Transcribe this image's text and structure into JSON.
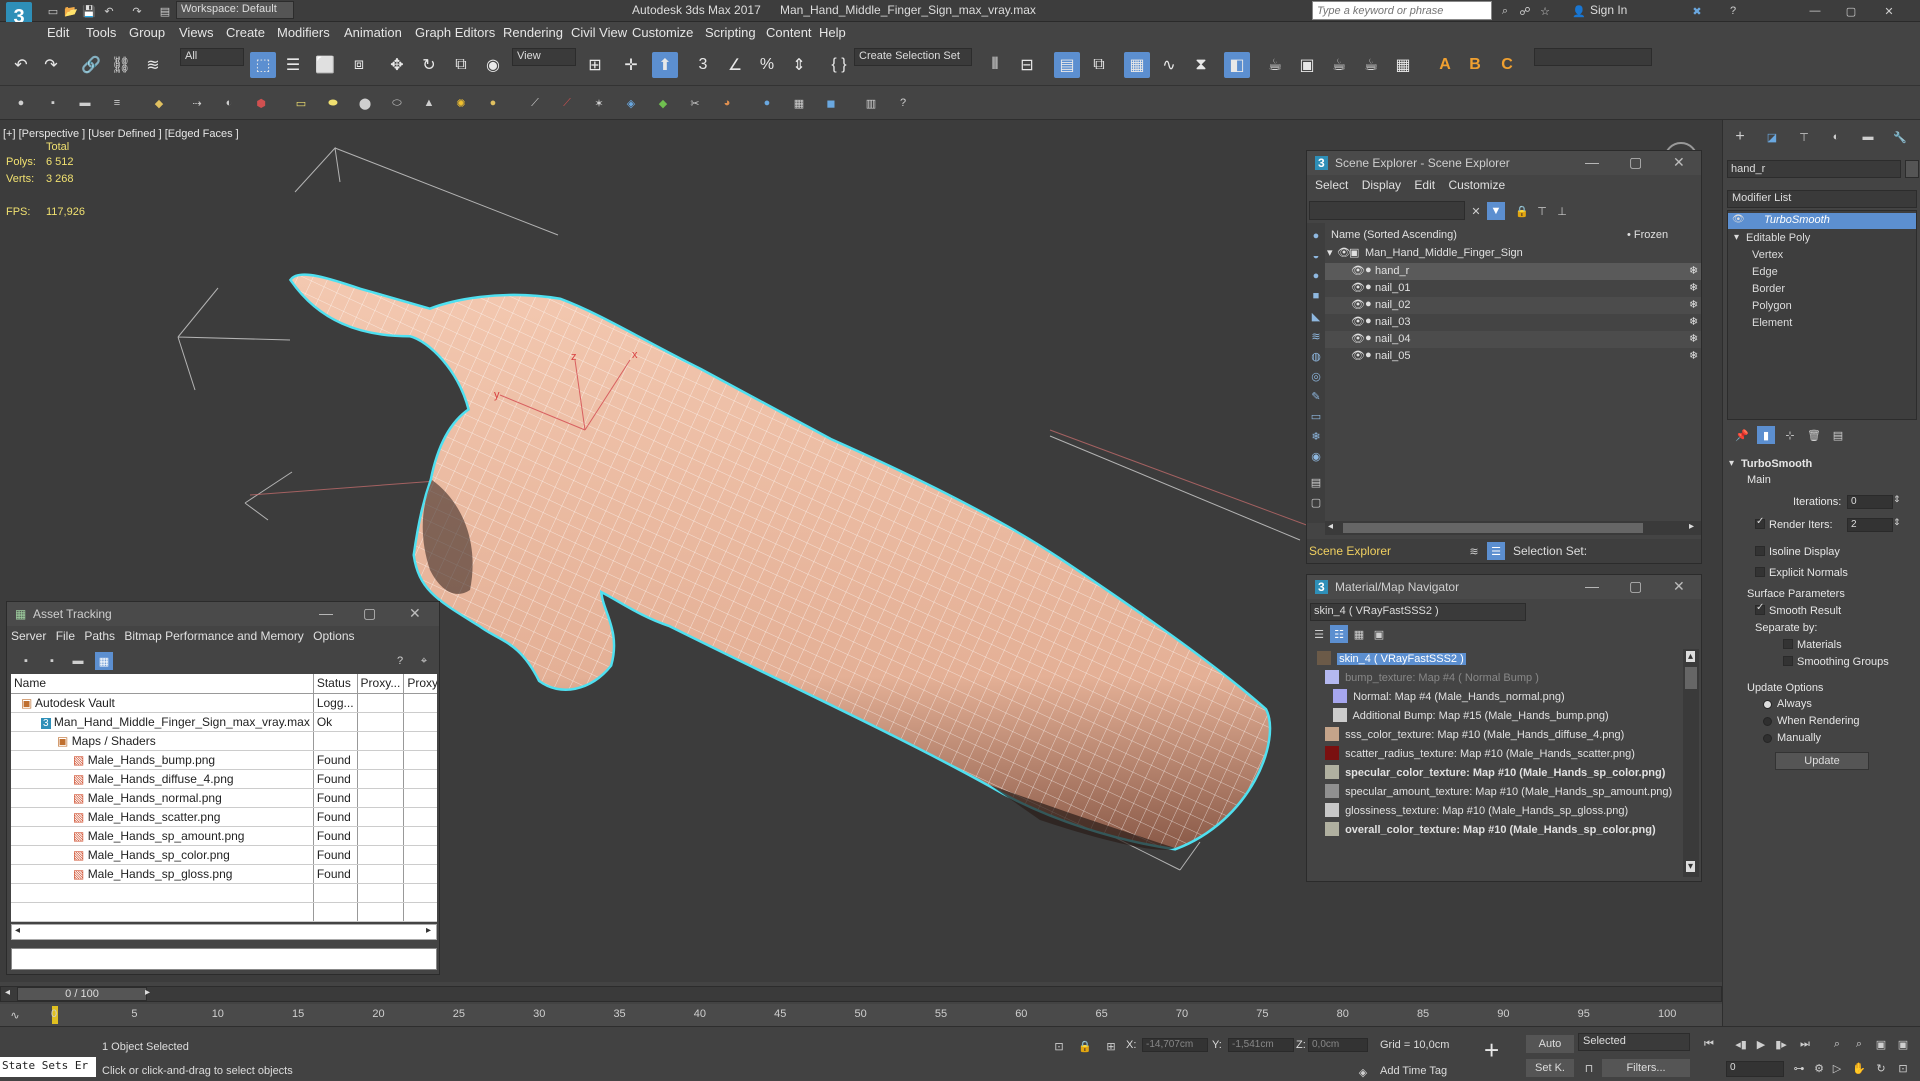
{
  "titlebar": {
    "app_title": "Autodesk 3ds Max 2017",
    "file_title": "Man_Hand_Middle_Finger_Sign_max_vray.max",
    "workspace": "Workspace: Default",
    "search_placeholder": "Type a keyword or phrase",
    "sign_in": "Sign In"
  },
  "menu": [
    "Edit",
    "Tools",
    "Group",
    "Views",
    "Create",
    "Modifiers",
    "Animation",
    "Graph Editors",
    "Rendering",
    "Civil View",
    "Customize",
    "Scripting",
    "Content",
    "Help"
  ],
  "toolbar": {
    "selection_filter": "All",
    "ref_coord": "View",
    "create_selection_set": "Create Selection Set"
  },
  "viewport": {
    "label": "[+] [Perspective ] [User Defined ] [Edged Faces ]",
    "stats_total": "Total",
    "polys_label": "Polys:",
    "polys_value": "6 512",
    "verts_label": "Verts:",
    "verts_value": "3 268",
    "fps_label": "FPS:",
    "fps_value": "117,926",
    "gizmo": {
      "x": "x",
      "y": "y",
      "z": "z"
    }
  },
  "scene_explorer": {
    "title": "Scene Explorer - Scene Explorer",
    "menu": [
      "Select",
      "Display",
      "Edit",
      "Customize"
    ],
    "col_name": "Name (Sorted Ascending)",
    "col_frozen": "• Frozen",
    "root": "Man_Hand_Middle_Finger_Sign",
    "items": [
      "hand_r",
      "nail_01",
      "nail_02",
      "nail_03",
      "nail_04",
      "nail_05"
    ],
    "footer_label": "Scene Explorer",
    "selection_set": "Selection Set:"
  },
  "material_navigator": {
    "title": "Material/Map Navigator",
    "current": "skin_4  ( VRayFastSSS2 )",
    "rows": [
      {
        "text": "skin_4  ( VRayFastSSS2 )",
        "color": "#6b5a48"
      },
      {
        "text": "bump_texture: Map #4  ( Normal Bump )",
        "color": "#b4b8f0"
      },
      {
        "text": "Normal: Map #4 (Male_Hands_normal.png)",
        "color": "#a6a6ee"
      },
      {
        "text": "Additional Bump: Map #15 (Male_Hands_bump.png)",
        "color": "#cccccc"
      },
      {
        "text": "sss_color_texture: Map #10 (Male_Hands_diffuse_4.png)",
        "color": "#c4a48a"
      },
      {
        "text": "scatter_radius_texture: Map #10 (Male_Hands_scatter.png)",
        "color": "#7a1010"
      },
      {
        "text": "specular_color_texture: Map #10 (Male_Hands_sp_color.png)",
        "color": "#b0b0a0"
      },
      {
        "text": "specular_amount_texture: Map #10 (Male_Hands_sp_amount.png)",
        "color": "#909090"
      },
      {
        "text": "glossiness_texture: Map #10 (Male_Hands_sp_gloss.png)",
        "color": "#c8c8c8"
      },
      {
        "text": "overall_color_texture: Map #10 (Male_Hands_sp_color.png)",
        "color": "#b0b0a0"
      }
    ]
  },
  "asset_tracking": {
    "title": "Asset Tracking",
    "menu": [
      "Server",
      "File",
      "Paths",
      "Bitmap Performance and Memory",
      "Options"
    ],
    "headers": [
      "Name",
      "Status",
      "Proxy...",
      "Proxy..."
    ],
    "rows": [
      {
        "name": "Autodesk Vault",
        "status": "Logg..."
      },
      {
        "name": "Man_Hand_Middle_Finger_Sign_max_vray.max",
        "status": "Ok"
      },
      {
        "name": "Maps / Shaders",
        "status": ""
      },
      {
        "name": "Male_Hands_bump.png",
        "status": "Found"
      },
      {
        "name": "Male_Hands_diffuse_4.png",
        "status": "Found"
      },
      {
        "name": "Male_Hands_normal.png",
        "status": "Found"
      },
      {
        "name": "Male_Hands_scatter.png",
        "status": "Found"
      },
      {
        "name": "Male_Hands_sp_amount.png",
        "status": "Found"
      },
      {
        "name": "Male_Hands_sp_color.png",
        "status": "Found"
      },
      {
        "name": "Male_Hands_sp_gloss.png",
        "status": "Found"
      }
    ]
  },
  "command_panel": {
    "object_name": "hand_r",
    "modifier_list": "Modifier List",
    "stack": [
      "TurboSmooth",
      "Editable Poly",
      "Vertex",
      "Edge",
      "Border",
      "Polygon",
      "Element"
    ],
    "rollout_title": "TurboSmooth",
    "main": "Main",
    "iterations_label": "Iterations:",
    "iterations_value": "0",
    "render_iters_label": "Render Iters:",
    "render_iters_value": "2",
    "isoline": "Isoline Display",
    "explicit_normals": "Explicit Normals",
    "surface_params": "Surface Parameters",
    "smooth_result": "Smooth Result",
    "separate_by": "Separate by:",
    "materials": "Materials",
    "smoothing_groups": "Smoothing Groups",
    "update_options": "Update Options",
    "always": "Always",
    "when_rendering": "When Rendering",
    "manually": "Manually",
    "update_button": "Update"
  },
  "timeline": {
    "frame_counter": "0 / 100",
    "ticks": [
      "0",
      "5",
      "10",
      "15",
      "20",
      "25",
      "30",
      "35",
      "40",
      "45",
      "50",
      "55",
      "60",
      "65",
      "70",
      "75",
      "80",
      "85",
      "90",
      "95",
      "100"
    ]
  },
  "status": {
    "maxscript": "State Sets Er",
    "selected": "1 Object Selected",
    "prompt": "Click or click-and-drag to select objects",
    "x_label": "X:",
    "x_value": "-14,707cm",
    "y_label": "Y:",
    "y_value": "-1,541cm",
    "z_label": "Z:",
    "z_value": "0,0cm",
    "grid": "Grid = 10,0cm",
    "add_time_tag": "Add Time Tag",
    "auto": "Auto",
    "set_key": "Set K.",
    "key_mode": "Selected",
    "filters": "Filters...",
    "frame": "0"
  },
  "colors": {
    "accent": "#5c8fd0",
    "selection_outline": "#4fe0f0",
    "skin": "#e8b8a0",
    "status_yellow": "#f0e070"
  }
}
